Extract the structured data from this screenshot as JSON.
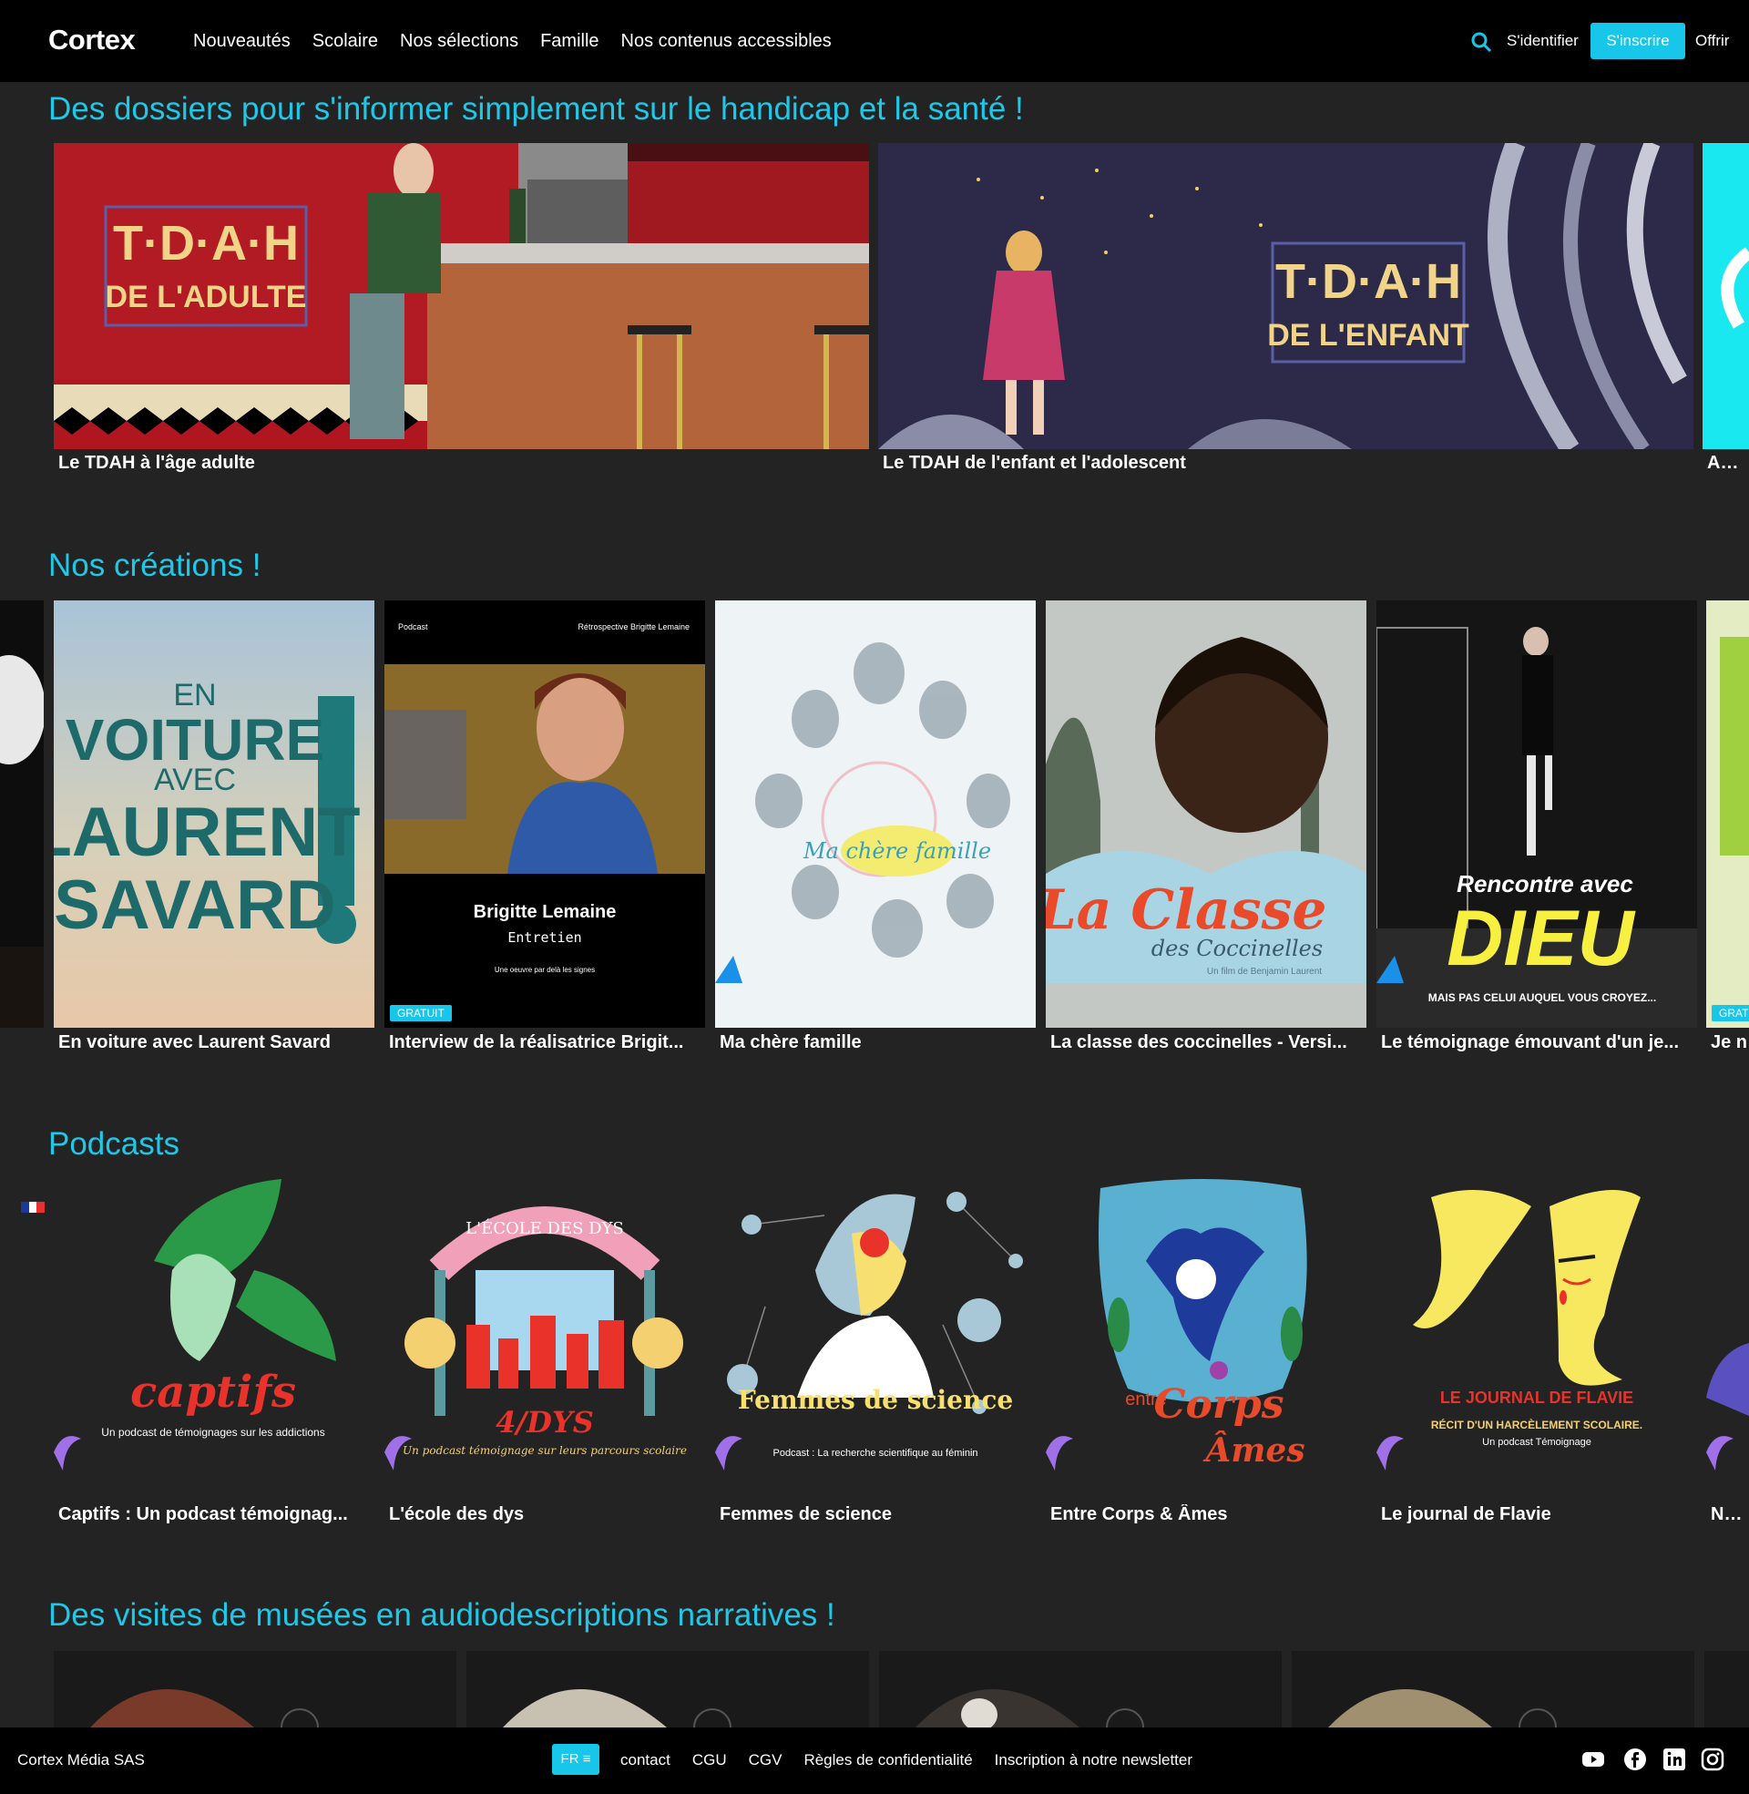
{
  "header": {
    "logo": "Cortex",
    "nav": [
      "Nouveautés",
      "Scolaire",
      "Nos sélections",
      "Famille",
      "Nos contenus accessibles"
    ],
    "login": "S'identifier",
    "signup": "S'inscrire",
    "offer": "Offrir"
  },
  "sections": {
    "dossiers": {
      "title": "Des dossiers pour s'informer simplement sur le handicap et la santé !",
      "items": [
        {
          "label": "Le TDAH à l'âge adulte",
          "art_title": "T·D·A·H",
          "art_sub": "DE L'ADULTE"
        },
        {
          "label": "Le TDAH de l'enfant et l'adolescent",
          "art_title": "T·D·A·H",
          "art_sub": "DE L'ENFANT"
        },
        {
          "label": "Autis"
        }
      ]
    },
    "creations": {
      "title": "Nos créations !",
      "items": [
        {
          "label": "En voiture avec Laurent Savard",
          "art": [
            "EN",
            "VOITURE",
            "AVEC",
            "LAURENT",
            "SAVARD"
          ]
        },
        {
          "label": "Interview de la réalisatrice Brigit...",
          "badge": "GRATUIT",
          "art_top_left": "Podcast",
          "art_top_right": "Rétrospective Brigitte Lemaine",
          "art_name": "Brigitte Lemaine",
          "art_sub": "Entretien",
          "art_tag": "Une oeuvre par delà les signes"
        },
        {
          "label": "Ma chère famille",
          "art": "Ma chère famille"
        },
        {
          "label": "La classe des coccinelles - Versi...",
          "art_title": "La Classe",
          "art_sub": "des Coccinelles",
          "art_credit": "Un film de Benjamin Laurent"
        },
        {
          "label": "Le témoignage émouvant d'un je...",
          "art_top": "Rencontre avec",
          "art_main": "DIEU",
          "art_sub": "MAIS PAS CELUI AUQUEL VOUS CROYEZ..."
        },
        {
          "label": "Je n",
          "badge": "GRAT"
        }
      ]
    },
    "podcasts": {
      "title": "Podcasts",
      "items": [
        {
          "label": "Captifs : Un podcast témoignag...",
          "art_title": "captifs",
          "art_sub": "Un podcast de témoignages sur les addictions"
        },
        {
          "label": "L'école des dys",
          "art_arch": "L'ÉCOLE DES DYS",
          "art_title": "4/DYS",
          "art_sub": "Un podcast témoignage sur leurs parcours scolaire"
        },
        {
          "label": "Femmes de science",
          "art_title": "Femmes de science",
          "art_sub": "Podcast : La recherche scientifique au féminin"
        },
        {
          "label": "Entre Corps & Âmes",
          "art_title": "Corps",
          "art_pre": "entre",
          "art_sub": "Âmes"
        },
        {
          "label": "Le journal de Flavie",
          "art_title": "LE JOURNAL DE FLAVIE",
          "art_sub": "RÉCIT D'UN HARCÈLEMENT SCOLAIRE.",
          "art_sub2": "Un podcast Témoignage"
        },
        {
          "label": "Nous"
        }
      ]
    },
    "musees": {
      "title": "Des visites de musées en audiodescriptions narratives !"
    }
  },
  "footer": {
    "company": "Cortex Média SAS",
    "lang": "FR ≡",
    "links": [
      "contact",
      "CGU",
      "CGV",
      "Règles de confidentialité",
      "Inscription à notre newsletter"
    ]
  },
  "colors": {
    "accent": "#17c6e8",
    "background": "#232323",
    "header": "#000000"
  }
}
